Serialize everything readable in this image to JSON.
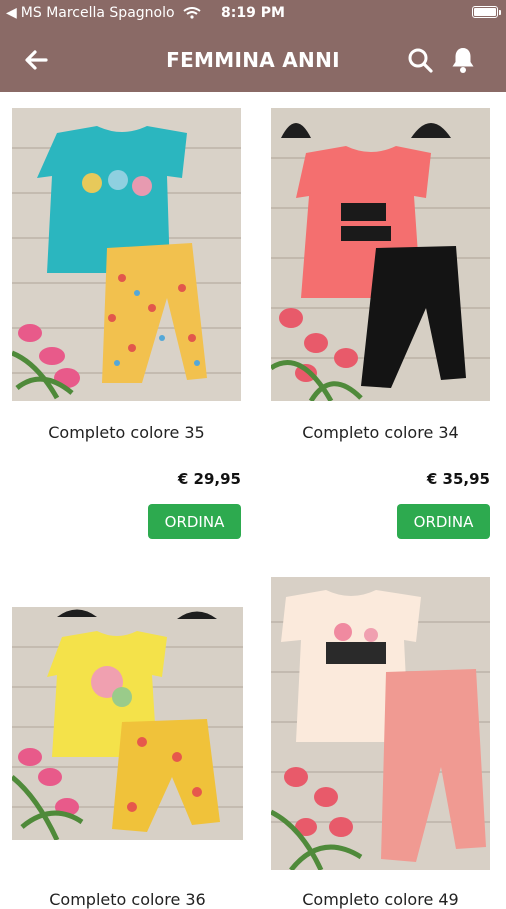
{
  "status": {
    "carrier": "MS Marcella Spagnolo",
    "time": "8:19 PM",
    "battery_level": 1.0
  },
  "header": {
    "title": "FEMMINA ANNI"
  },
  "icons": {
    "back": "back-arrow-icon",
    "search": "search-icon",
    "bell": "bell-icon"
  },
  "colors": {
    "header_bg": "#8a6a66",
    "button_bg": "#2daa4f"
  },
  "products": [
    {
      "name": "Completo colore 35",
      "price": "€ 29,95",
      "order_label": "ORDINA"
    },
    {
      "name": "Completo colore 34",
      "price": "€ 35,95",
      "order_label": "ORDINA"
    },
    {
      "name": "Completo colore 36",
      "price": "",
      "order_label": ""
    },
    {
      "name": "Completo colore 49",
      "price": "",
      "order_label": ""
    }
  ]
}
